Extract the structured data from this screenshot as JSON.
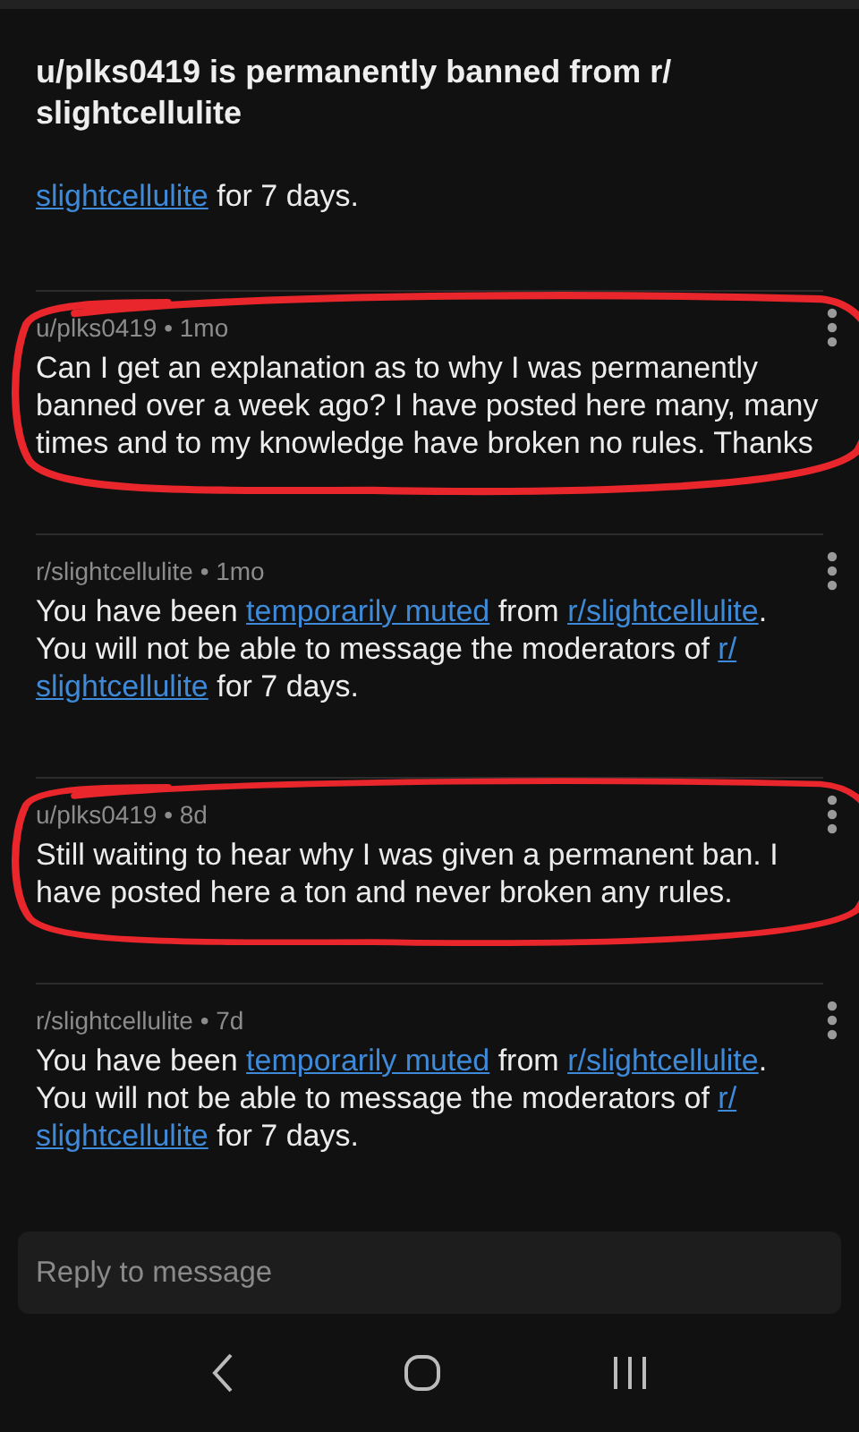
{
  "header": {
    "title": "u/plks0419 is permanently banned from r/ slightcellulite"
  },
  "messages": [
    {
      "body": [
        {
          "kind": "link",
          "text": "slightcellulite"
        },
        {
          "kind": "text",
          "text": " for 7 days."
        }
      ]
    },
    {
      "meta": "u/plks0419 • 1mo",
      "circled": true,
      "body": [
        {
          "kind": "text",
          "text": "Can I get an explanation as to why I was permanently banned over a week ago? I have posted here many, many times and to my knowledge have broken no rules. Thanks"
        }
      ]
    },
    {
      "meta": "r/slightcellulite • 1mo",
      "circled": false,
      "body": [
        {
          "kind": "text",
          "text": "You have been "
        },
        {
          "kind": "link",
          "text": "temporarily muted"
        },
        {
          "kind": "text",
          "text": " from "
        },
        {
          "kind": "link",
          "text": "r/slightcellulite"
        },
        {
          "kind": "text",
          "text": ". You will not be able to message the moderators of "
        },
        {
          "kind": "link",
          "text": "r/"
        },
        {
          "kind": "link",
          "text": "slightcellulite"
        },
        {
          "kind": "text",
          "text": " for 7 days."
        }
      ]
    },
    {
      "meta": "u/plks0419 • 8d",
      "circled": true,
      "body": [
        {
          "kind": "text",
          "text": "Still waiting to hear why I was given a permanent ban. I have posted here a ton and never broken any rules."
        }
      ]
    },
    {
      "meta": "r/slightcellulite • 7d",
      "circled": false,
      "body": [
        {
          "kind": "text",
          "text": "You have been "
        },
        {
          "kind": "link",
          "text": "temporarily muted"
        },
        {
          "kind": "text",
          "text": " from "
        },
        {
          "kind": "link",
          "text": "r/slightcellulite"
        },
        {
          "kind": "text",
          "text": ". You will not be able to message the moderators of "
        },
        {
          "kind": "link",
          "text": "r/"
        },
        {
          "kind": "link",
          "text": "slightcellulite"
        },
        {
          "kind": "text",
          "text": " for 7 days."
        }
      ]
    }
  ],
  "reply": {
    "placeholder": "Reply to message"
  }
}
